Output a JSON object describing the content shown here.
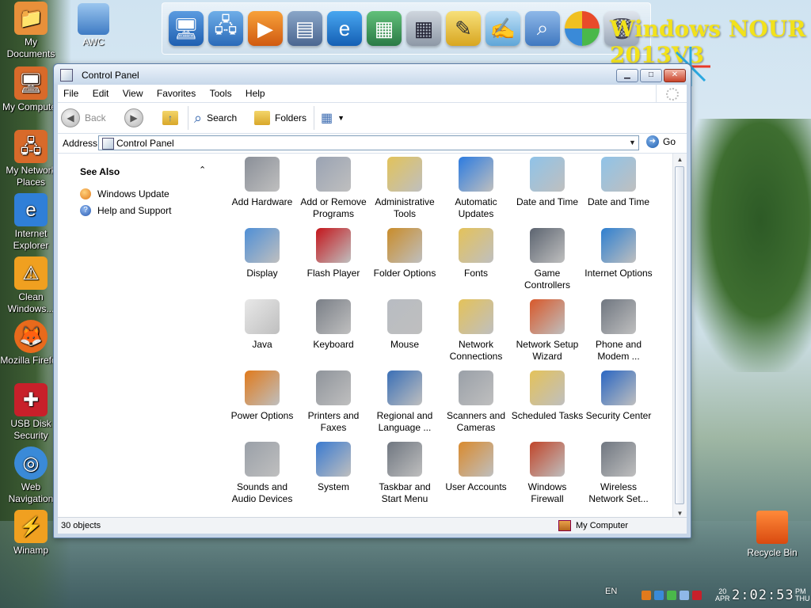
{
  "window": {
    "title": "Control Panel",
    "menu": [
      "File",
      "Edit",
      "View",
      "Favorites",
      "Tools",
      "Help"
    ],
    "toolbar": {
      "back": "Back",
      "search": "Search",
      "folders": "Folders"
    },
    "address": {
      "label": "Address",
      "value": "Control Panel",
      "go": "Go"
    },
    "see_also": {
      "header": "See Also",
      "links": [
        "Windows Update",
        "Help and Support"
      ]
    },
    "items": [
      {
        "label": "Add Hardware",
        "icon": "hardware-icon",
        "color": "#8a8f98"
      },
      {
        "label": "Add or Remove Programs",
        "icon": "programs-icon",
        "color": "#9aa3b3"
      },
      {
        "label": "Administrative Tools",
        "icon": "admin-tools-icon",
        "color": "#e2c35a"
      },
      {
        "label": "Automatic Updates",
        "icon": "windows-logo-icon",
        "color": "#2c7be0"
      },
      {
        "label": "Date and Time",
        "icon": "calendar-clock-icon",
        "color": "#8fc3e8"
      },
      {
        "label": "Date and Time",
        "icon": "calendar-clock-icon",
        "color": "#8fc3e8"
      },
      {
        "label": "Display",
        "icon": "display-icon",
        "color": "#4f8fd6"
      },
      {
        "label": "Flash Player",
        "icon": "flash-icon",
        "color": "#c4161c"
      },
      {
        "label": "Folder Options",
        "icon": "folder-options-icon",
        "color": "#c98c2a"
      },
      {
        "label": "Fonts",
        "icon": "fonts-icon",
        "color": "#e4c25a"
      },
      {
        "label": "Game Controllers",
        "icon": "gamepad-icon",
        "color": "#5c6470"
      },
      {
        "label": "Internet Options",
        "icon": "globe-icon",
        "color": "#2e7fd0"
      },
      {
        "label": "Java",
        "icon": "java-icon",
        "color": "#e8e8e8"
      },
      {
        "label": "Keyboard",
        "icon": "keyboard-icon",
        "color": "#7a7f87"
      },
      {
        "label": "Mouse",
        "icon": "mouse-icon",
        "color": "#b8bcc2"
      },
      {
        "label": "Network Connections",
        "icon": "network-icon",
        "color": "#e4c25a"
      },
      {
        "label": "Network Setup Wizard",
        "icon": "network-setup-icon",
        "color": "#d8582a"
      },
      {
        "label": "Phone and Modem ...",
        "icon": "phone-icon",
        "color": "#6f7680"
      },
      {
        "label": "Power Options",
        "icon": "power-icon",
        "color": "#e07a1c"
      },
      {
        "label": "Printers and Faxes",
        "icon": "printer-icon",
        "color": "#8f949b"
      },
      {
        "label": "Regional and Language ...",
        "icon": "regional-icon",
        "color": "#3a6fb6"
      },
      {
        "label": "Scanners and Cameras",
        "icon": "scanner-icon",
        "color": "#9aa0a8"
      },
      {
        "label": "Scheduled Tasks",
        "icon": "scheduled-tasks-icon",
        "color": "#e4c25a"
      },
      {
        "label": "Security Center",
        "icon": "shield-icon",
        "color": "#2a66c2"
      },
      {
        "label": "Sounds and Audio Devices",
        "icon": "speaker-icon",
        "color": "#9aa0a8"
      },
      {
        "label": "System",
        "icon": "system-icon",
        "color": "#3a7ad0"
      },
      {
        "label": "Taskbar and Start Menu",
        "icon": "taskbar-icon",
        "color": "#6f7680"
      },
      {
        "label": "User Accounts",
        "icon": "users-icon",
        "color": "#d98a2e"
      },
      {
        "label": "Windows Firewall",
        "icon": "firewall-icon",
        "color": "#c0452a"
      },
      {
        "label": "Wireless Network Set...",
        "icon": "wireless-icon",
        "color": "#6f7680"
      }
    ],
    "status": {
      "count": "30 objects",
      "zone": "My Computer"
    }
  },
  "desktop": {
    "watermark": "Windows NOUR 2013V3",
    "awc": "AWC",
    "icons": [
      {
        "label": "My Documents",
        "color": "#e8903a"
      },
      {
        "label": "My Computer",
        "color": "#d86a2a"
      },
      {
        "label": "My Network Places",
        "color": "#d86a2a"
      },
      {
        "label": "Internet Explorer",
        "color": "#2f7fd8"
      },
      {
        "label": "Clean Windows...",
        "color": "#f0a020"
      },
      {
        "label": "Mozilla Firefox",
        "color": "#e86a1c"
      },
      {
        "label": "USB Disk Security",
        "color": "#c8202a"
      },
      {
        "label": "Web Navigation",
        "color": "#3a8ad8"
      },
      {
        "label": "Winamp",
        "color": "#f0a020"
      }
    ],
    "recycle": "Recycle Bin"
  },
  "tray": {
    "lang": "EN",
    "date_day": "20",
    "date_month": "APR",
    "time": "2:02:53",
    "weekday_top": "PM",
    "weekday_bottom": "THU"
  }
}
